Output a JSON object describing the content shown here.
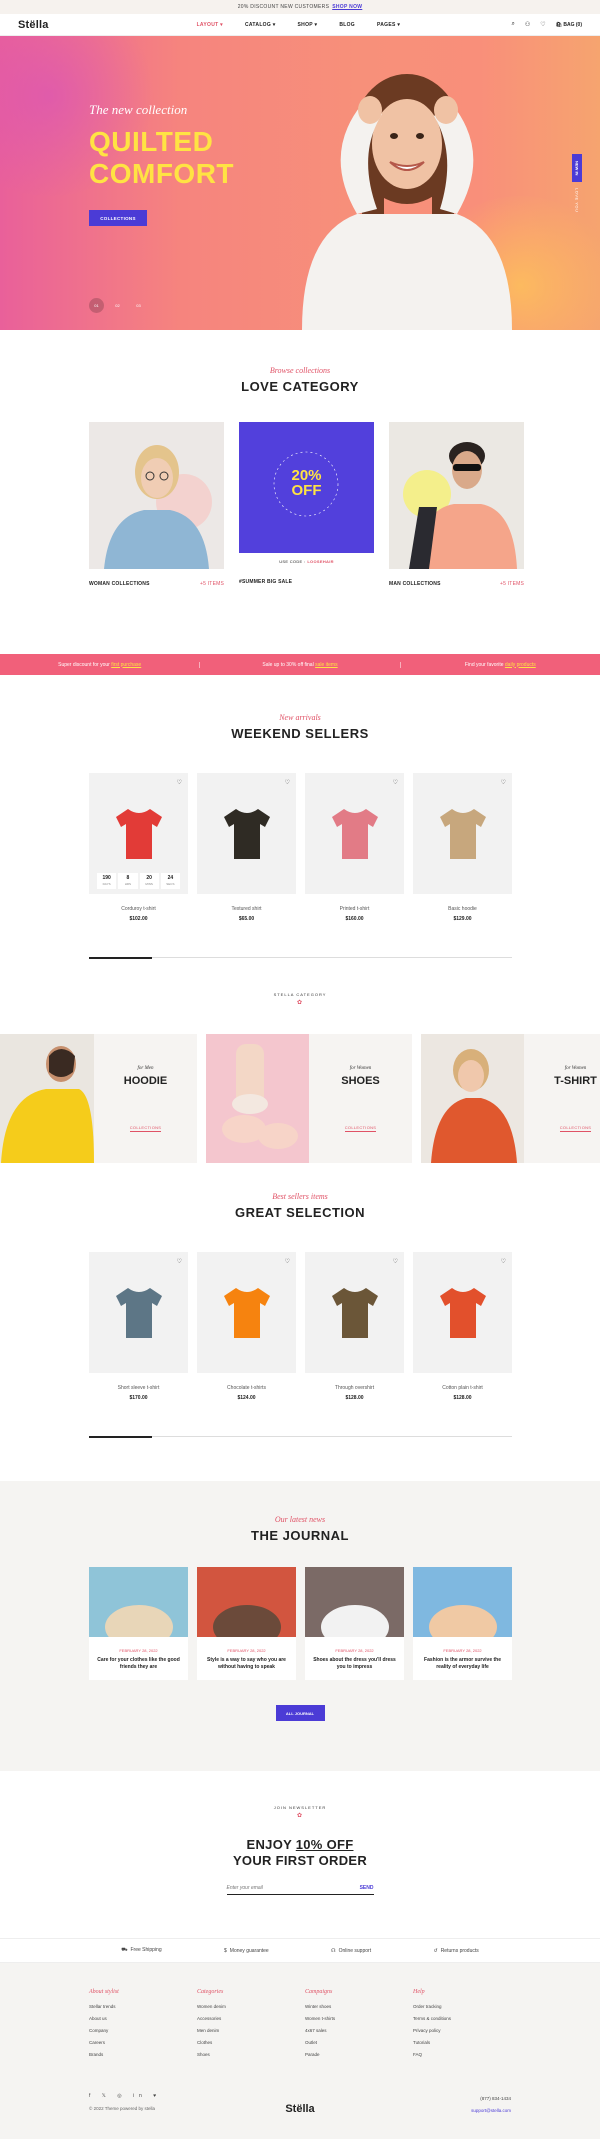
{
  "topbar": {
    "text": "20% DISCOUNT NEW CUSTOMERS",
    "link": "SHOP NOW"
  },
  "nav": {
    "logo": "Stëlla",
    "menu": [
      "LAYOUT",
      "CATALOG",
      "SHOP",
      "BLOG",
      "PAGES"
    ],
    "bag": "BAG (0)"
  },
  "hero": {
    "subtitle": "The new collection",
    "title_1": "QUILTED",
    "title_2": "COMFORT",
    "cta": "COLLECTIONS",
    "dots": [
      "01",
      "02",
      "03"
    ],
    "side_tag": "NEW IN",
    "side_text": "LOVE YOU"
  },
  "love": {
    "eyebrow": "Browse collections",
    "title": "LOVE CATEGORY",
    "cards": [
      {
        "label": "WOMAN COLLECTIONS",
        "count": "+5 ITEMS"
      },
      {
        "label": "#SUMMER BIG SALE",
        "count": ""
      },
      {
        "label": "MAN COLLECTIONS",
        "count": "+5 ITEMS"
      }
    ],
    "promo_pct": "20%",
    "promo_off": "OFF",
    "promo_ring": "T-SHIRTS · JEANS · SWEATERS ·",
    "promo_code_label": "USE CODE :",
    "promo_code": "LOOSEHAIR"
  },
  "strip": [
    {
      "text": "Super discount for your",
      "link": "first purchase"
    },
    {
      "text": "Sale up to 30% off final",
      "link": "sale items"
    },
    {
      "text": "Find your favorite",
      "link": "daily products"
    }
  ],
  "weekend": {
    "eyebrow": "New arrivals",
    "title": "WEEKEND SELLERS",
    "products": [
      {
        "name": "Corduroy t-shirt",
        "price": "$102.00",
        "color": "#e23b37"
      },
      {
        "name": "Textured shirt",
        "price": "$65.00",
        "color": "#2f2b24"
      },
      {
        "name": "Printed t-shirt",
        "price": "$160.00",
        "color": "#e27b86"
      },
      {
        "name": "Basic hoodie",
        "price": "$129.00",
        "color": "#c7a77d"
      }
    ],
    "countdown": [
      {
        "v": "190",
        "l": "DAYS"
      },
      {
        "v": "8",
        "l": "HRS"
      },
      {
        "v": "20",
        "l": "MINS"
      },
      {
        "v": "24",
        "l": "SECS"
      }
    ]
  },
  "stella": {
    "badge": "STELLA CATEGORY",
    "items": [
      {
        "small": "for Men",
        "big": "HOODIE",
        "link": "COLLECTIONS"
      },
      {
        "small": "for Women",
        "big": "SHOES",
        "link": "COLLECTIONS"
      },
      {
        "small": "for Women",
        "big": "T-SHIRT",
        "link": "COLLECTIONS"
      }
    ]
  },
  "great": {
    "eyebrow": "Best sellers items",
    "title": "GREAT SELECTION",
    "products": [
      {
        "name": "Short sleeve t-shirt",
        "price": "$170.00",
        "color": "#5d7686"
      },
      {
        "name": "Chocolate t-shirts",
        "price": "$124.00",
        "color": "#f6830f"
      },
      {
        "name": "Through overshirt",
        "price": "$128.00",
        "color": "#6b5638"
      },
      {
        "name": "Cotton plain t-shirt",
        "price": "$128.00",
        "color": "#e2502c"
      }
    ]
  },
  "journal": {
    "eyebrow": "Our latest news",
    "title": "THE JOURNAL",
    "posts": [
      {
        "date": "FEBRUARY 28, 2022",
        "title": "Care for your clothes like the good friends they are"
      },
      {
        "date": "FEBRUARY 28, 2022",
        "title": "Style is a way to say who you are without having to speak"
      },
      {
        "date": "FEBRUARY 28, 2022",
        "title": "Shoes about the dress you'll dress you to impress"
      },
      {
        "date": "FEBRUARY 28, 2022",
        "title": "Fashion is the armor survive the reality of everyday life"
      }
    ],
    "button": "ALL JOURNAL"
  },
  "newsletter": {
    "badge": "JOIN NEWSLETTER",
    "line1_pre": "ENJOY ",
    "line1_u": "10% OFF",
    "line2": "YOUR FIRST ORDER",
    "placeholder": "Enter your email",
    "send": "SEND"
  },
  "features": [
    "Free Shipping",
    "Money guarantee",
    "Online support",
    "Returns products"
  ],
  "footer": {
    "cols": [
      {
        "title": "About stylist",
        "items": [
          "Stellar trends",
          "About us",
          "Company",
          "Careers",
          "Brands"
        ]
      },
      {
        "title": "Categories",
        "items": [
          "Women denim",
          "Accessories",
          "Men denim",
          "Clothes",
          "Shoes"
        ]
      },
      {
        "title": "Campaigns",
        "items": [
          "Winter shoes",
          "Women t-shirts",
          "4x67 sales",
          "Outlet",
          "Parade"
        ]
      },
      {
        "title": "Help",
        "items": [
          "Order tracking",
          "Terms & conditions",
          "Privacy policy",
          "Tutorials",
          "FAQ"
        ]
      }
    ],
    "logo": "Stëlla",
    "socials": "f  𝕏  ◎  in  ♥",
    "copyright": "© 2022 Theme powered by stella",
    "phone": "(877) 834-1434",
    "email": "support@stella.com"
  }
}
